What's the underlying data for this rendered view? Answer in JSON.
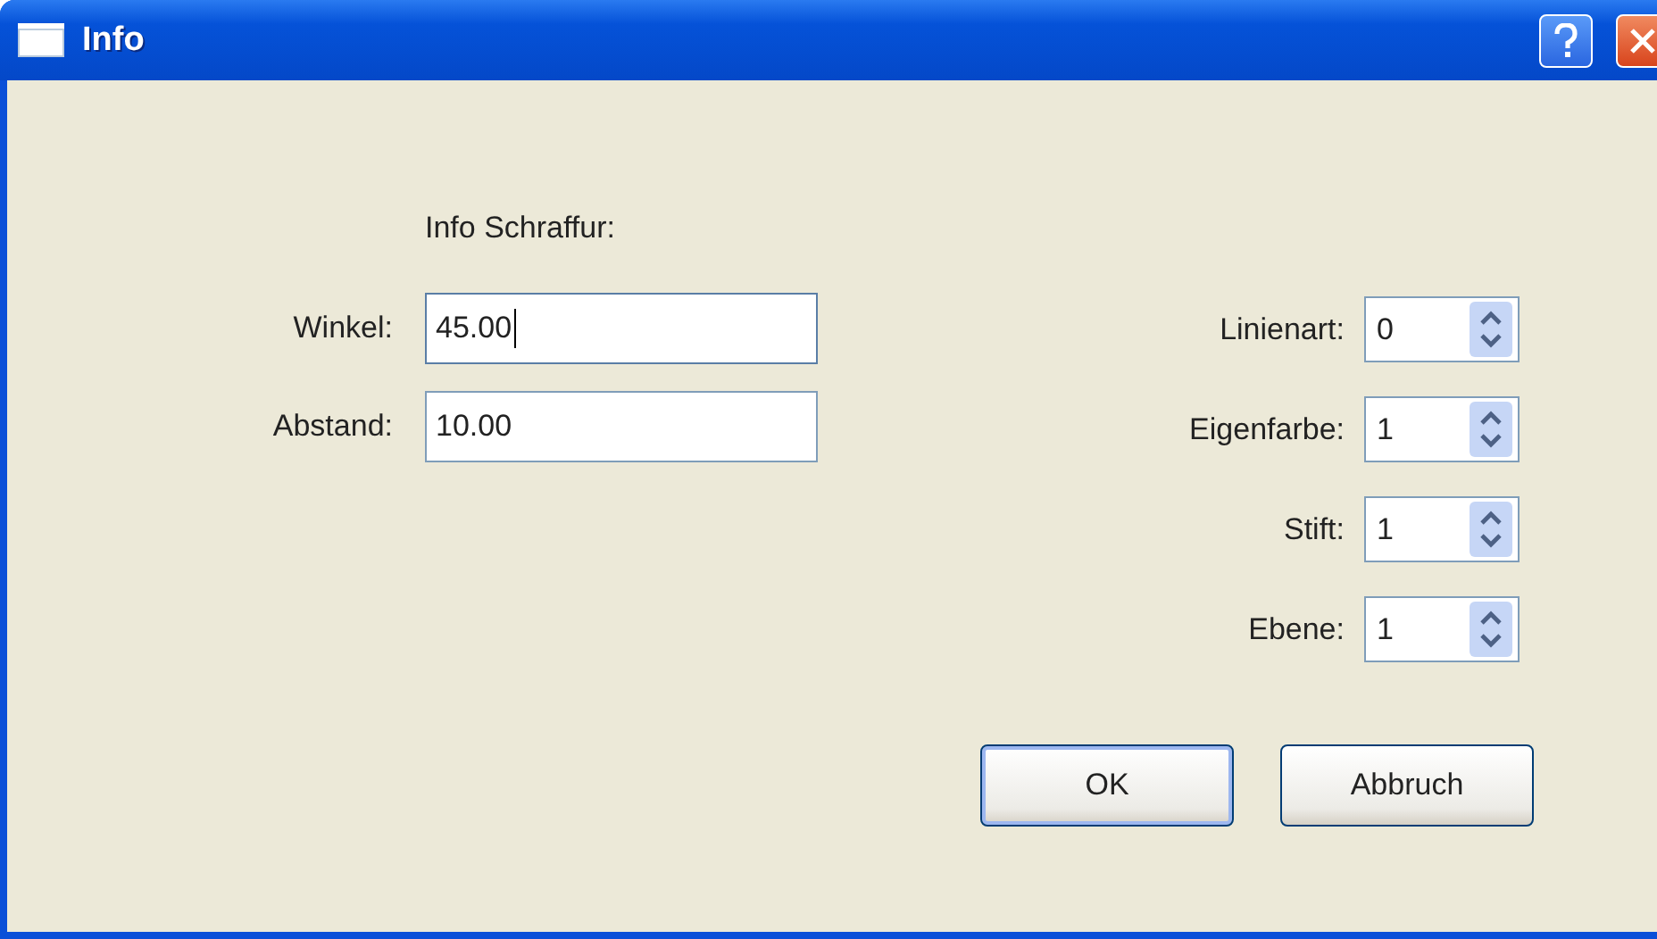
{
  "window": {
    "title": "Info"
  },
  "heading": "Info Schraffur:",
  "fields": [
    {
      "label": "Winkel:",
      "value": "45.00",
      "focused": true
    },
    {
      "label": "Abstand:",
      "value": "10.00",
      "focused": false
    }
  ],
  "spinners": [
    {
      "label": "Linienart:",
      "value": "0"
    },
    {
      "label": "Eigenfarbe:",
      "value": "1"
    },
    {
      "label": "Stift:",
      "value": "1"
    },
    {
      "label": "Ebene:",
      "value": "1"
    }
  ],
  "buttons": [
    {
      "label": "OK",
      "default": true
    },
    {
      "label": "Abbruch",
      "default": false
    }
  ]
}
